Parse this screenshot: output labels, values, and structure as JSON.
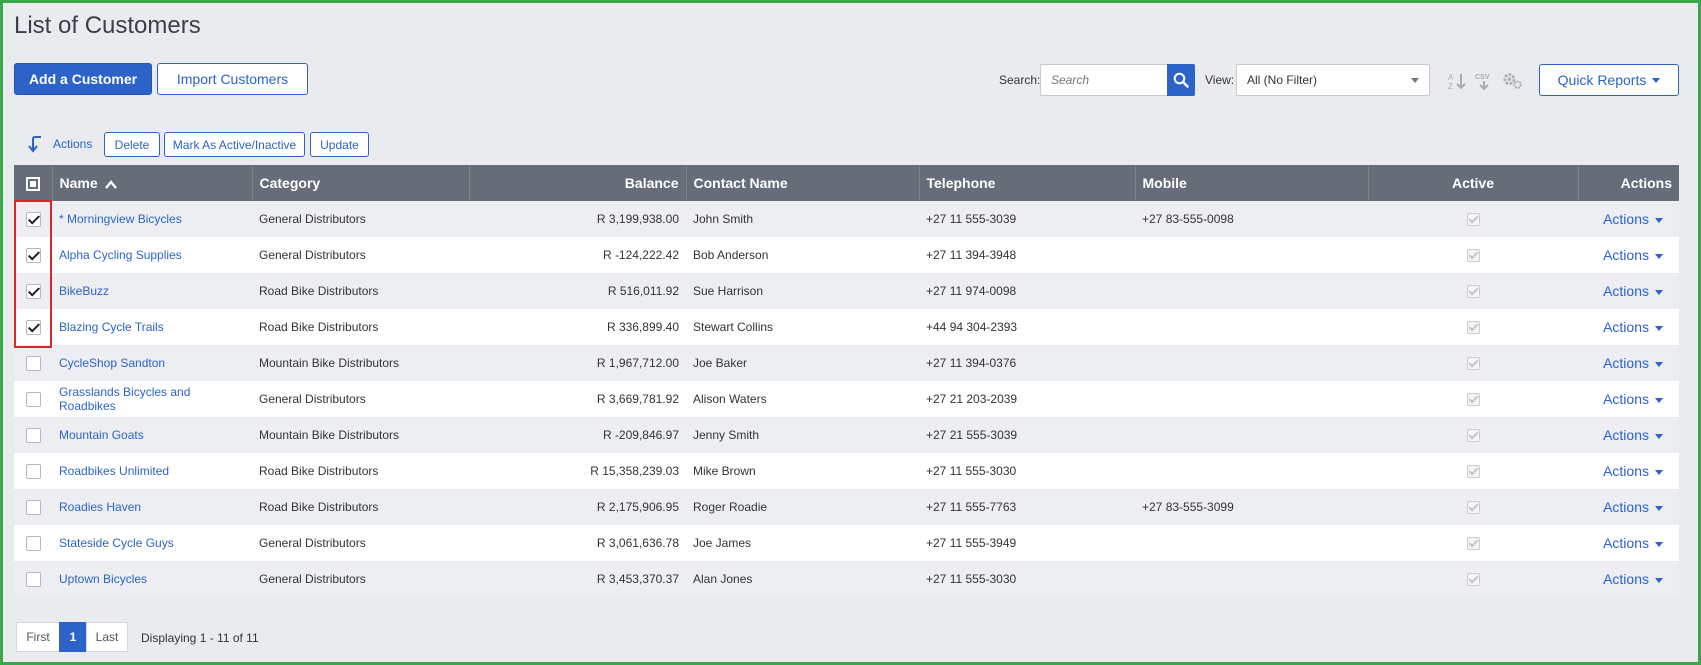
{
  "page": {
    "title": "List of Customers"
  },
  "toolbar": {
    "add_label": "Add a Customer",
    "import_label": "Import Customers",
    "search_label": "Search:",
    "search_placeholder": "Search",
    "view_label": "View:",
    "view_value": "All (No Filter)",
    "quick_reports_label": "Quick Reports"
  },
  "bulk_actions": {
    "label": "Actions",
    "delete_label": "Delete",
    "mark_label": "Mark As Active/Inactive",
    "update_label": "Update"
  },
  "table": {
    "headers": {
      "name": "Name",
      "category": "Category",
      "balance": "Balance",
      "contact": "Contact Name",
      "telephone": "Telephone",
      "mobile": "Mobile",
      "active": "Active",
      "actions": "Actions"
    },
    "rows": [
      {
        "checked": true,
        "name": "* Morningview Bicycles",
        "category": "General Distributors",
        "balance": "R 3,199,938.00",
        "contact": "John Smith",
        "telephone": "+27 11 555-3039",
        "mobile": "+27 83-555-0098",
        "active": true,
        "actions": "Actions"
      },
      {
        "checked": true,
        "name": "Alpha Cycling Supplies",
        "category": "General Distributors",
        "balance": "R -124,222.42",
        "contact": "Bob Anderson",
        "telephone": "+27 11 394-3948",
        "mobile": "",
        "active": true,
        "actions": "Actions"
      },
      {
        "checked": true,
        "name": "BikeBuzz",
        "category": "Road Bike Distributors",
        "balance": "R 516,011.92",
        "contact": "Sue Harrison",
        "telephone": "+27 11 974-0098",
        "mobile": "",
        "active": true,
        "actions": "Actions"
      },
      {
        "checked": true,
        "name": "Blazing Cycle Trails",
        "category": "Road Bike Distributors",
        "balance": "R 336,899.40",
        "contact": "Stewart Collins",
        "telephone": "+44 94 304-2393",
        "mobile": "",
        "active": true,
        "actions": "Actions"
      },
      {
        "checked": false,
        "name": "CycleShop Sandton",
        "category": "Mountain Bike Distributors",
        "balance": "R 1,967,712.00",
        "contact": "Joe Baker",
        "telephone": "+27 11 394-0376",
        "mobile": "",
        "active": true,
        "actions": "Actions"
      },
      {
        "checked": false,
        "name": "Grasslands Bicycles and Roadbikes",
        "category": "General Distributors",
        "balance": "R 3,669,781.92",
        "contact": "Alison Waters",
        "telephone": "+27 21 203-2039",
        "mobile": "",
        "active": true,
        "actions": "Actions"
      },
      {
        "checked": false,
        "name": "Mountain Goats",
        "category": "Mountain Bike Distributors",
        "balance": "R -209,846.97",
        "contact": "Jenny Smith",
        "telephone": "+27 21 555-3039",
        "mobile": "",
        "active": true,
        "actions": "Actions"
      },
      {
        "checked": false,
        "name": "Roadbikes Unlimited",
        "category": "Road Bike Distributors",
        "balance": "R 15,358,239.03",
        "contact": "Mike Brown",
        "telephone": "+27 11 555-3030",
        "mobile": "",
        "active": true,
        "actions": "Actions"
      },
      {
        "checked": false,
        "name": "Roadies Haven",
        "category": "Road Bike Distributors",
        "balance": "R 2,175,906.95",
        "contact": "Roger Roadie",
        "telephone": "+27 11 555-7763",
        "mobile": "+27 83-555-3099",
        "active": true,
        "actions": "Actions"
      },
      {
        "checked": false,
        "name": "Stateside Cycle Guys",
        "category": "General Distributors",
        "balance": "R 3,061,636.78",
        "contact": "Joe James",
        "telephone": "+27 11 555-3949",
        "mobile": "",
        "active": true,
        "actions": "Actions"
      },
      {
        "checked": false,
        "name": "Uptown Bicycles",
        "category": "General Distributors",
        "balance": "R 3,453,370.37",
        "contact": "Alan Jones",
        "telephone": "+27 11 555-3030",
        "mobile": "",
        "active": true,
        "actions": "Actions"
      }
    ]
  },
  "pagination": {
    "first_label": "First",
    "current_page": "1",
    "last_label": "Last",
    "info": "Displaying 1 - 11 of 11"
  },
  "colors": {
    "accent": "#2d63c8",
    "header_bg": "#666d78",
    "frame": "#3aa84a",
    "highlight": "#d8262c"
  },
  "icons": [
    "search-icon",
    "sort-icon",
    "csv-icon",
    "gear-icon",
    "caret-down-icon",
    "return-arrow-icon"
  ]
}
